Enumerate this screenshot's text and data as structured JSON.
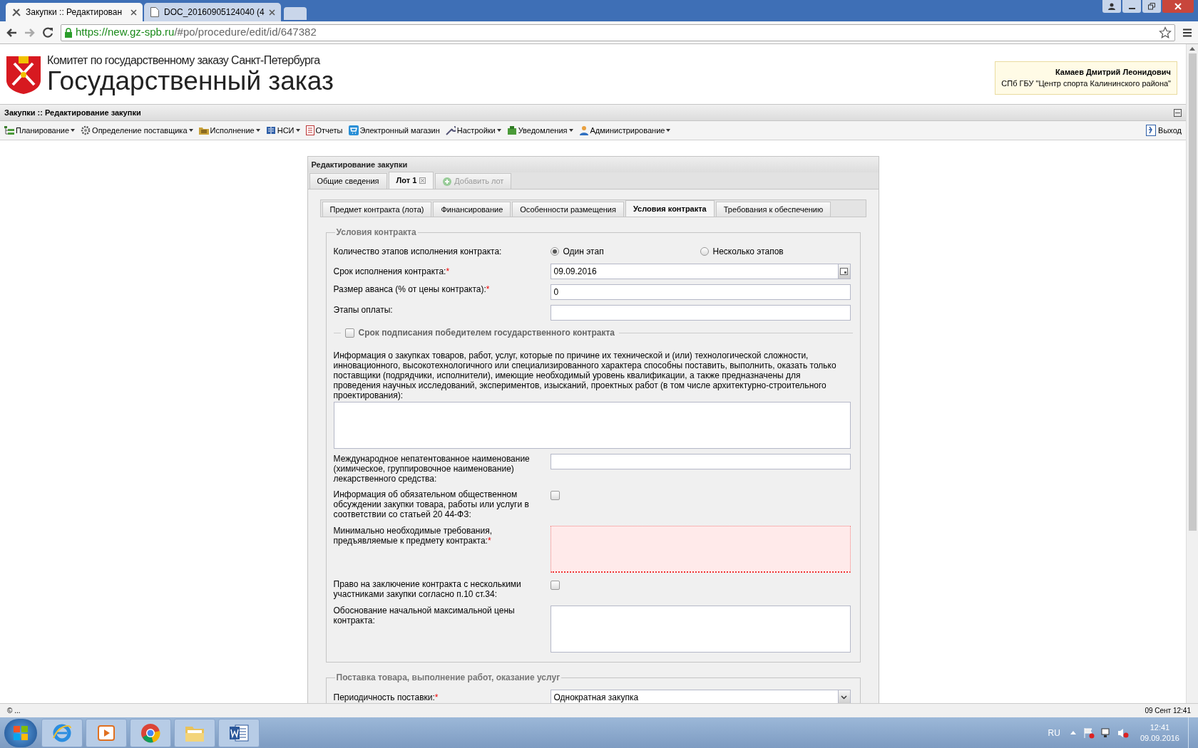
{
  "browser": {
    "tabs": [
      {
        "title": "Закупки :: Редактирован",
        "selected": true
      },
      {
        "title": "DOC_20160905124040 (4",
        "selected": false
      }
    ],
    "url_secure": "https://",
    "url_host": "new.gz-spb.ru",
    "url_path": "/#po/procedure/edit/id/647382"
  },
  "header": {
    "subtitle": "Комитет по государственному заказу Санкт-Петербурга",
    "title": "Государственный заказ",
    "user_name": "Камаев Дмитрий Леонидович",
    "user_org": "СПб ГБУ \"Центр спорта Калининского района\""
  },
  "app_title": "Закупки :: Редактирование закупки",
  "menu": [
    {
      "label": "Планирование",
      "dropdown": true
    },
    {
      "label": "Определение поставщика",
      "dropdown": true
    },
    {
      "label": "Исполнение",
      "dropdown": true
    },
    {
      "label": "НСИ",
      "dropdown": true
    },
    {
      "label": "Отчеты",
      "dropdown": false
    },
    {
      "label": "Электронный магазин",
      "dropdown": false
    },
    {
      "label": "Настройки",
      "dropdown": true
    },
    {
      "label": "Уведомления",
      "dropdown": true
    },
    {
      "label": "Администрирование",
      "dropdown": true
    }
  ],
  "logout": "Выход",
  "panel": {
    "title": "Редактирование закупки",
    "tabs": [
      {
        "label": "Общие сведения",
        "selected": false,
        "closable": false,
        "disabled": false
      },
      {
        "label": "Лот 1",
        "selected": true,
        "closable": true,
        "disabled": false
      },
      {
        "label": "Добавить лот",
        "selected": false,
        "closable": false,
        "disabled": true
      }
    ],
    "subtabs": [
      {
        "label": "Предмет контракта (лота)",
        "selected": false
      },
      {
        "label": "Финансирование",
        "selected": false
      },
      {
        "label": "Особенности размещения",
        "selected": false
      },
      {
        "label": "Условия контракта",
        "selected": true
      },
      {
        "label": "Требования к обеспечению",
        "selected": false
      }
    ],
    "sections": [
      {
        "legend": "Условия контракта",
        "rows": [
          {
            "kind": "radio",
            "label": "Количество этапов исполнения контракта:",
            "options": [
              {
                "label": "Один этап",
                "selected": true
              },
              {
                "label": "Несколько этапов",
                "selected": false
              }
            ]
          },
          {
            "kind": "date",
            "label": "Срок исполнения контракта:",
            "required_mark": "*",
            "value": "09.09.2016"
          },
          {
            "kind": "text",
            "label": "Размер аванса (% от цены контракта):",
            "required_mark": "*",
            "value": "0"
          },
          {
            "kind": "text",
            "label": "Этапы оплаты:"
          },
          {
            "kind": "group",
            "label": "Срок подписания победителем государственного контракта",
            "checked": false
          },
          {
            "kind": "wide",
            "label": "Информация о закупках товаров, работ, услуг, которые по причине их технической и (или) технологической сложности, инновационного, высокотехнологичного или специализированного характера способны поставить, выполнить, оказать только поставщики (подрядчики, исполнители), имеющие необходимый уровень квалификации, а также предназначены для проведения научных исследований, экспериментов, изысканий, проектных работ (в том числе архитектурно-строительного проектирования):"
          },
          {
            "kind": "text",
            "label": "Международное непатентованное наименование (химическое, группировочное наименование) лекарственного средства:"
          },
          {
            "kind": "checkbox",
            "label": "Информация об обязательном общественном обсуждении закупки товара, работы или услуги в соответствии со статьей 20 44-ФЗ:",
            "checked": false
          },
          {
            "kind": "textarea",
            "label": "Минимально необходимые требования, предъявляемые к предмету контракта:",
            "required_mark": "*",
            "invalid": true
          },
          {
            "kind": "checkbox",
            "label": "Право на заключение контракта с несколькими участниками закупки согласно п.10 ст.34:",
            "checked": false
          },
          {
            "kind": "textarea",
            "label": "Обоснование начальной максимальной цены контракта:",
            "invalid": false
          }
        ]
      },
      {
        "legend": "Поставка товара, выполнение работ, оказание услуг",
        "rows": [
          {
            "kind": "select",
            "label": "Периодичность поставки:",
            "required_mark": "*",
            "value": "Однократная закупка"
          }
        ]
      }
    ]
  },
  "status_left": "© ...",
  "status_right": "09 Сент 12:41",
  "taskbar": {
    "lang": "RU",
    "time": "12:41",
    "date": "09.09.2016"
  }
}
